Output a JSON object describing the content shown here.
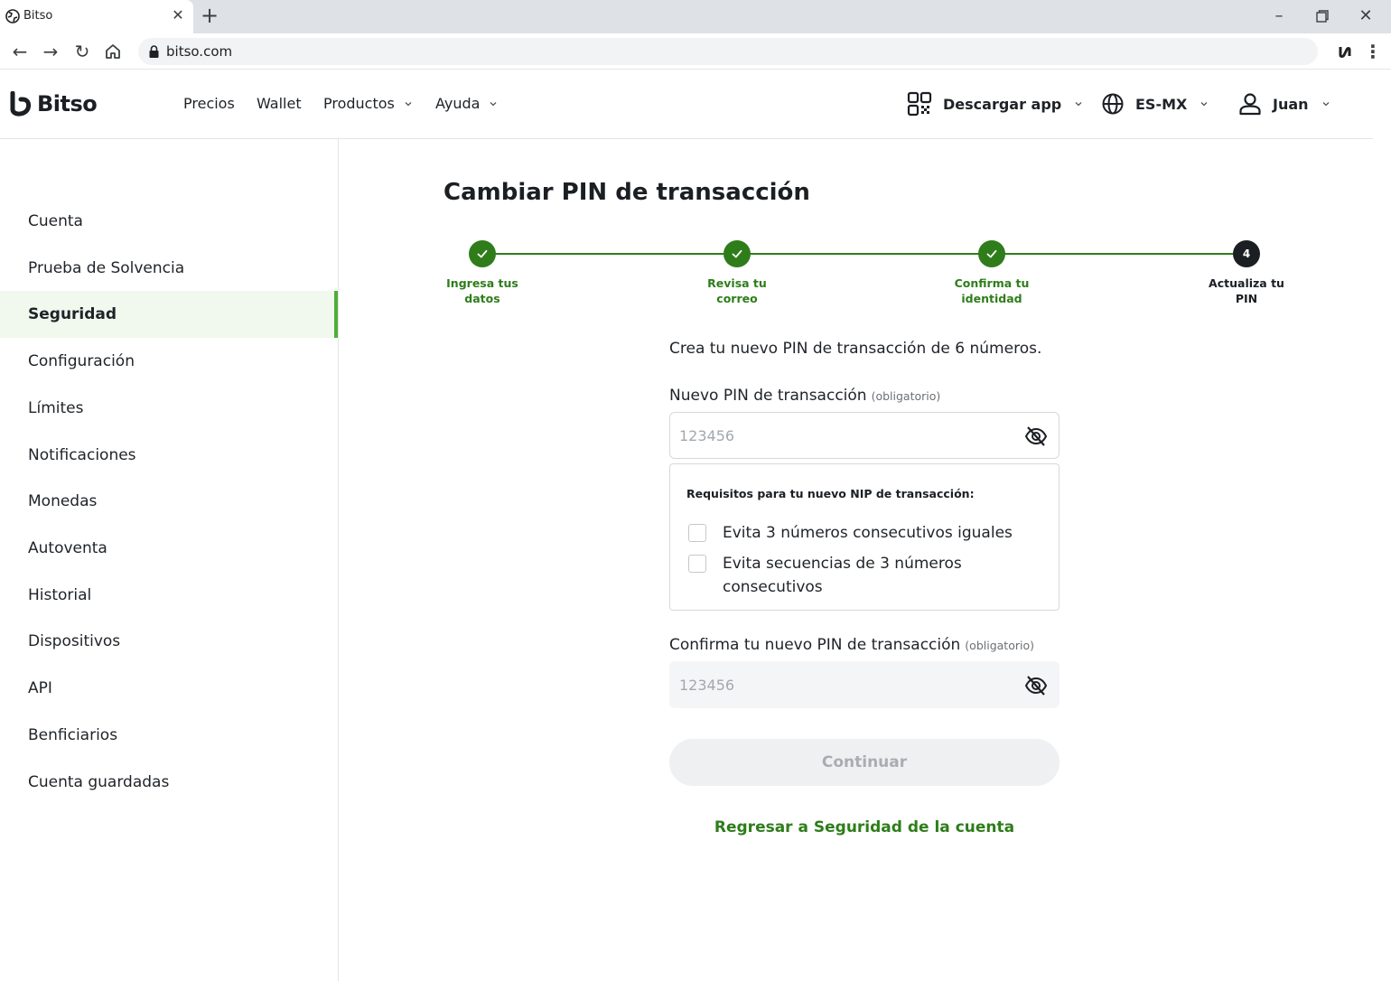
{
  "browser": {
    "tab_title": "Bitso",
    "url": "bitso.com"
  },
  "header": {
    "logo_text": "Bitso",
    "nav": [
      {
        "label": "Precios"
      },
      {
        "label": "Wallet"
      },
      {
        "label": "Productos"
      },
      {
        "label": "Ayuda"
      }
    ],
    "download_app": "Descargar app",
    "language": "ES-MX",
    "user": "Juan"
  },
  "sidebar": {
    "items": [
      {
        "label": "Cuenta"
      },
      {
        "label": "Prueba de Solvencia"
      },
      {
        "label": "Seguridad",
        "active": true
      },
      {
        "label": "Configuración"
      },
      {
        "label": "Límites"
      },
      {
        "label": "Notificaciones"
      },
      {
        "label": "Monedas"
      },
      {
        "label": "Autoventa"
      },
      {
        "label": "Historial"
      },
      {
        "label": "Dispositivos"
      },
      {
        "label": "API"
      },
      {
        "label": "Benficiarios"
      },
      {
        "label": "Cuenta guardadas"
      }
    ]
  },
  "main": {
    "title": "Cambiar PIN de transacción",
    "steps": [
      {
        "line1": "Ingresa tus",
        "line2": "datos",
        "status": "done"
      },
      {
        "line1": "Revisa tu",
        "line2": "correo",
        "status": "done"
      },
      {
        "line1": "Confirma tu",
        "line2": "identidad",
        "status": "done"
      },
      {
        "line1": "Actualiza tu",
        "line2": "PIN",
        "status": "current",
        "number": "4"
      }
    ],
    "intro": "Crea tu nuevo PIN de transacción de 6 números.",
    "new_pin": {
      "label": "Nuevo PIN de transacción",
      "required": "(obligatorio)",
      "placeholder": "123456"
    },
    "requirements": {
      "title": "Requisitos para tu nuevo NIP de transacción:",
      "items": [
        {
          "text": "Evita 3 números consecutivos iguales",
          "checked": false
        },
        {
          "text": "Evita secuencias de 3 números consecutivos",
          "checked": false
        }
      ]
    },
    "confirm_pin": {
      "label": "Confirma tu nuevo PIN de transacción",
      "required": "(obligatorio)",
      "placeholder": "123456"
    },
    "continue_label": "Continuar",
    "back_link": "Regresar a Seguridad de la cuenta"
  },
  "colors": {
    "accent_green": "#2e7d1a",
    "active_bg": "#f1f8ee",
    "active_bar": "#4caf36"
  }
}
